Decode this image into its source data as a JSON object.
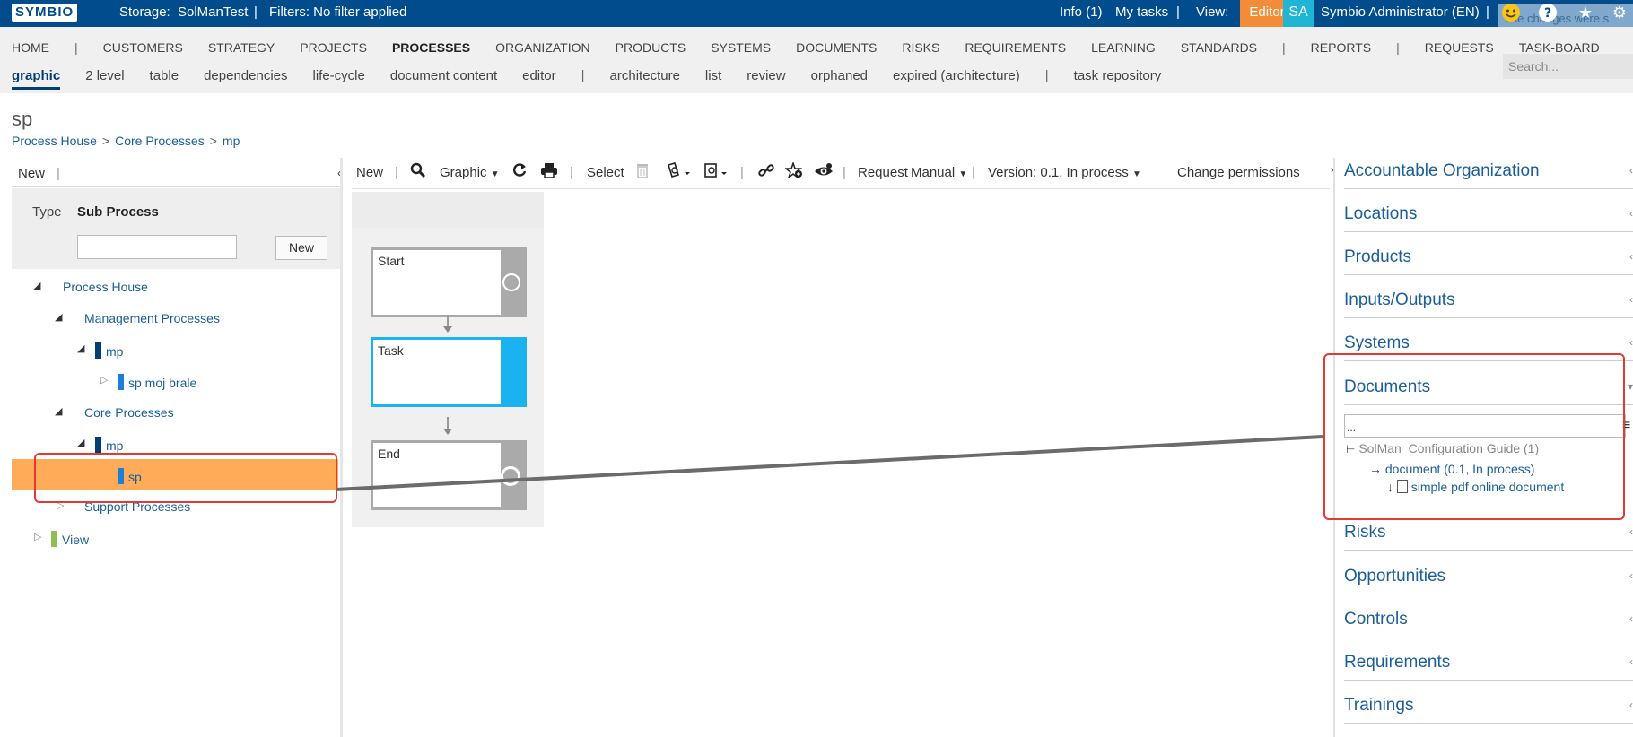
{
  "topbar": {
    "logo": "SYMBIO",
    "storage_label": "Storage:",
    "storage_value": "SolManTest",
    "sep1": "|",
    "filters": "Filters: No filter applied",
    "info": "Info (1)",
    "my_tasks": "My tasks",
    "sep2": "|",
    "view_label": "View:",
    "editor": "Editor",
    "avatar_initials": "SA",
    "user": "Symbio Administrator (EN)",
    "sep3": "|",
    "toast": "The changes were s"
  },
  "nav": {
    "main": [
      "HOME",
      "|",
      "CUSTOMERS",
      "STRATEGY",
      "PROJECTS",
      "PROCESSES",
      "ORGANIZATION",
      "PRODUCTS",
      "SYSTEMS",
      "DOCUMENTS",
      "RISKS",
      "REQUIREMENTS",
      "LEARNING",
      "STANDARDS",
      "|",
      "REPORTS",
      "|",
      "REQUESTS",
      "TASK-BOARD"
    ],
    "active_main": "PROCESSES",
    "sub": [
      "graphic",
      "2 level",
      "table",
      "dependencies",
      "life-cycle",
      "document content",
      "editor",
      "|",
      "architecture",
      "list",
      "review",
      "orphaned",
      "expired (architecture)",
      "|",
      "task repository"
    ],
    "active_sub": "graphic",
    "search_placeholder": "Search..."
  },
  "page": {
    "title": "sp",
    "breadcrumb": [
      "Process House",
      "Core Processes",
      "mp"
    ],
    "breadcrumb_sep": ">"
  },
  "left_panel": {
    "new_label": "New",
    "sep": "|",
    "type_label": "Type",
    "type_value": "Sub Process",
    "new_button": "New",
    "tree": {
      "process_house": "Process House",
      "management_processes": "Management Processes",
      "mp_1": "mp",
      "sp_moj_brale": "sp moj brale",
      "core_processes": "Core Processes",
      "mp_2": "mp",
      "sp": "sp",
      "support_processes": "Support Processes",
      "view": "View"
    }
  },
  "toolbar": {
    "new": "New",
    "graphic": "Graphic",
    "select": "Select",
    "request": "Request",
    "manual": "Manual",
    "version": "Version: 0.1, In process",
    "change_permissions": "Change permissions"
  },
  "diagram": {
    "start": "Start",
    "task": "Task",
    "end": "End"
  },
  "right_panel": {
    "sections": [
      "Accountable Organization",
      "Locations",
      "Products",
      "Inputs/Outputs",
      "Systems",
      "Documents",
      "Risks",
      "Opportunities",
      "Controls",
      "Requirements",
      "Trainings"
    ],
    "doc_input": "...",
    "doc_group": "SolMan_Configuration Guide (1)",
    "doc_item": "document (0.1, In process)",
    "doc_sub": "simple pdf online document"
  },
  "colors": {
    "topbar_bg": "#004c8c",
    "editor_bg": "#f28c38",
    "avatar_bg": "#1fb6d6",
    "link": "#1a5e9a",
    "selection": "#ffab58",
    "task_blue": "#1ab3f0",
    "highlight_red": "#e53935"
  }
}
